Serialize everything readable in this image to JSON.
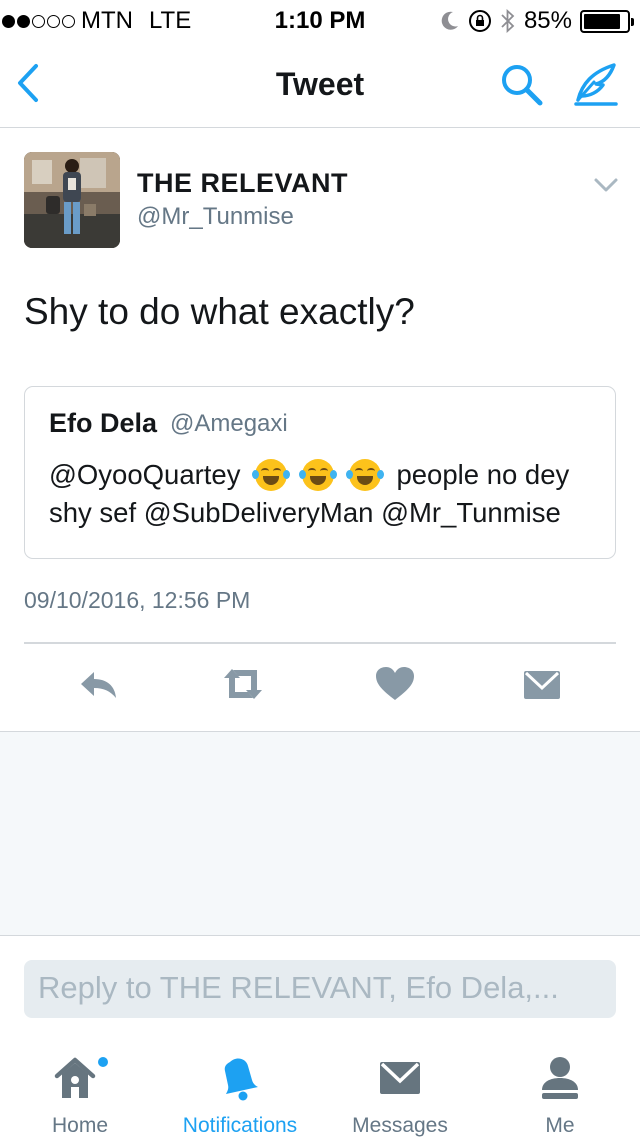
{
  "status_bar": {
    "carrier": "MTN",
    "network": "LTE",
    "time": "1:10 PM",
    "battery": "85%",
    "battery_level": 0.85,
    "signal_bars": 2
  },
  "nav": {
    "title": "Tweet",
    "back_icon": "chevron-left-icon",
    "search_icon": "search-icon",
    "compose_icon": "compose-icon"
  },
  "tweet": {
    "author_name": "THE RELEVANT",
    "author_handle": "@Mr_Tunmise",
    "text": "Shy to do what exactly?",
    "timestamp": "09/10/2016, 12:56 PM",
    "quoted": {
      "name": "Efo Dela",
      "handle": "@Amegaxi",
      "line1_start": "@OyooQuartey",
      "line1_end": "people no dey",
      "line2": "shy sef @SubDeliveryMan @Mr_Tunmise",
      "emoji_count": 3,
      "emoji_icon": "face-with-tears-of-joy-icon"
    }
  },
  "actions": [
    "reply-icon",
    "retweet-icon",
    "like-icon",
    "direct-message-icon"
  ],
  "reply_placeholder": "Reply to THE RELEVANT, Efo Dela,...",
  "tabs": [
    {
      "label": "Home",
      "icon": "home-icon",
      "active": false,
      "badge": true
    },
    {
      "label": "Notifications",
      "icon": "bell-icon",
      "active": true
    },
    {
      "label": "Messages",
      "icon": "envelope-icon",
      "active": false
    },
    {
      "label": "Me",
      "icon": "person-icon",
      "active": false
    }
  ],
  "colors": {
    "accent": "#1da1f2",
    "text": "#14171a",
    "secondary": "#657786",
    "divider": "#d4d8dc",
    "background_gray": "#f5f8fa"
  }
}
